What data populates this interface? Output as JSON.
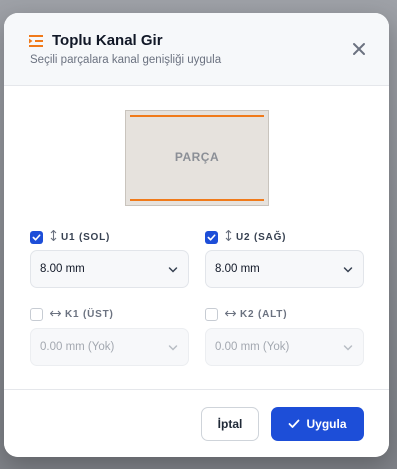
{
  "dialog": {
    "title": "Toplu Kanal Gir",
    "subtitle": "Seçili parçalara kanal genişliği uygula",
    "title_icon": "list-indent-icon",
    "close_icon": "close-icon"
  },
  "preview": {
    "label": "PARÇA",
    "edge_color": "#f07a1a"
  },
  "fields": {
    "u1": {
      "label": "U1 (SOL)",
      "checked": true,
      "direction_icon": "vertical-arrows-icon",
      "value": "8.00 mm"
    },
    "u2": {
      "label": "U2 (SAĞ)",
      "checked": true,
      "direction_icon": "vertical-arrows-icon",
      "value": "8.00 mm"
    },
    "k1": {
      "label": "K1 (ÜST)",
      "checked": false,
      "direction_icon": "horizontal-arrows-icon",
      "value": "0.00 mm (Yok)"
    },
    "k2": {
      "label": "K2 (ALT)",
      "checked": false,
      "direction_icon": "horizontal-arrows-icon",
      "value": "0.00 mm (Yok)"
    }
  },
  "footer": {
    "cancel_label": "İptal",
    "apply_label": "Uygula"
  },
  "colors": {
    "accent": "#1d4ed8",
    "edge": "#f07a1a"
  }
}
